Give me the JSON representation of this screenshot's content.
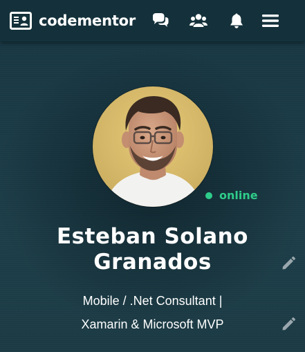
{
  "navbar": {
    "brand_name": "codementor",
    "icons": [
      "codementor-logo-icon",
      "chat-bubbles-icon",
      "users-group-icon",
      "bell-icon",
      "hamburger-menu-icon"
    ]
  },
  "profile": {
    "name": "Esteban Solano Granados",
    "status": "online",
    "headline_line1": "Mobile / .Net Consultant |",
    "headline_line2": "Xamarin & Microsoft MVP",
    "avatar_icon": "profile-photo",
    "edit_icons": [
      "pencil-icon",
      "pencil-icon"
    ]
  },
  "colors": {
    "navbar_bg": "#14313b",
    "hero_bg": "#1c3a45",
    "status_green": "#2ecc8a",
    "text_white": "#ffffff",
    "edit_icon_gray": "#9aa7ad"
  }
}
